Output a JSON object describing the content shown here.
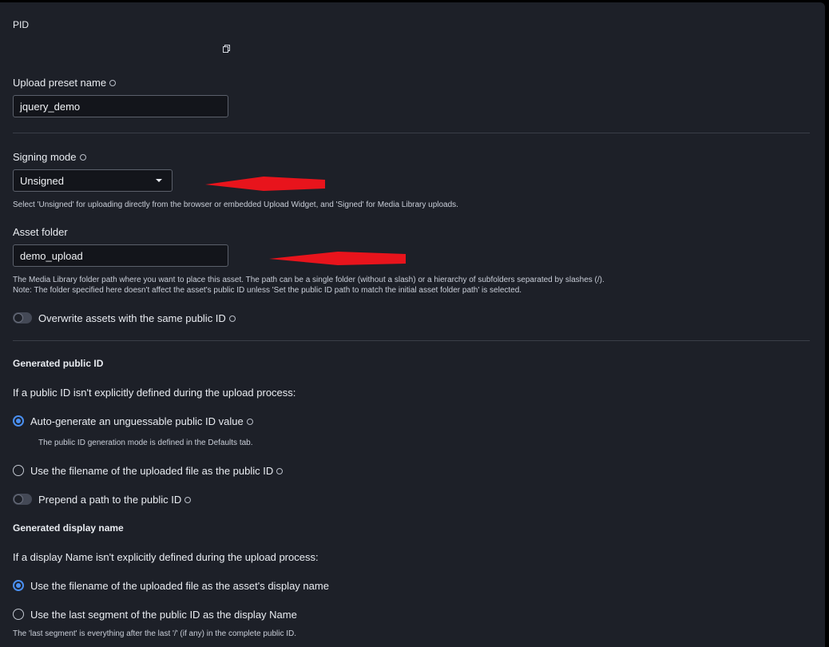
{
  "pid": {
    "label": "PID"
  },
  "preset_name": {
    "label": "Upload preset name",
    "value": "jquery_demo"
  },
  "signing": {
    "label": "Signing mode",
    "value": "Unsigned",
    "help": "Select 'Unsigned' for uploading directly from the browser or embedded Upload Widget, and 'Signed' for Media Library uploads."
  },
  "asset_folder": {
    "label": "Asset folder",
    "value": "demo_upload",
    "help1": "The Media Library folder path where you want to place this asset. The path can be a single folder (without a slash) or a hierarchy of subfolders separated by slashes (/).",
    "help2": "Note: The folder specified here doesn't affect the asset's public ID unless 'Set the public ID path to match the initial asset folder path' is selected."
  },
  "overwrite": {
    "label": "Overwrite assets with the same public ID",
    "enabled": false
  },
  "generated_public_id": {
    "heading": "Generated public ID",
    "intro": "If a public ID isn't explicitly defined during the upload process:",
    "option_auto": "Auto-generate an unguessable public ID value",
    "option_auto_help": "The public ID generation mode is defined in the Defaults tab.",
    "option_filename": "Use the filename of the uploaded file as the public ID",
    "selected": "auto",
    "prepend_label": "Prepend a path to the public ID",
    "prepend_enabled": false
  },
  "generated_display_name": {
    "heading": "Generated display name",
    "intro": "If a display Name isn't explicitly defined during the upload process:",
    "option_filename": "Use the filename of the uploaded file as the asset's display name",
    "option_segment": "Use the last segment of the public ID as the display Name",
    "selected": "filename",
    "help": "The 'last segment' is everything after the last '/' (if any) in the complete public ID."
  },
  "colors": {
    "accent": "#4a8ff0",
    "annotation_arrow": "#e8141c",
    "background": "#1d2028"
  }
}
